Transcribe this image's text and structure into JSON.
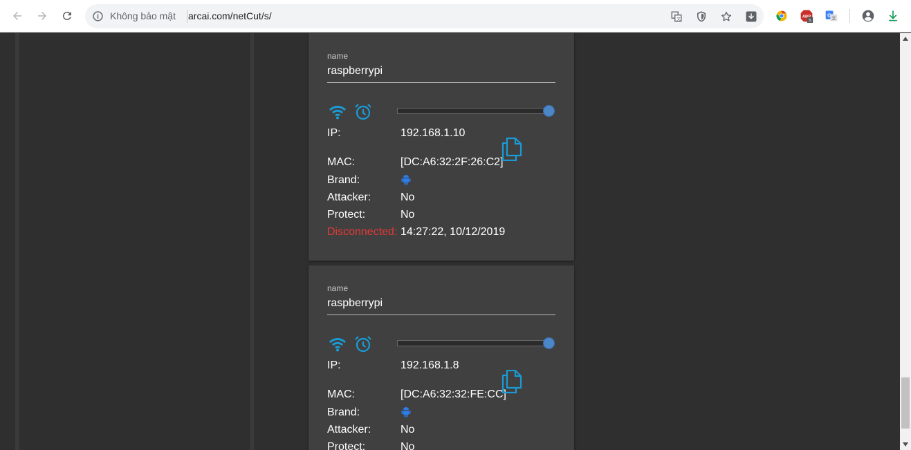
{
  "browser": {
    "security_label": "Không bảo mật",
    "url": "arcai.com/netCut/s/",
    "adblock_badge": "5",
    "abp_label": "ABP"
  },
  "cards": [
    {
      "name_label": "name",
      "name_value": "raspberrypi",
      "ip_label": "IP:",
      "ip_value": "192.168.1.10",
      "mac_label": "MAC:",
      "mac_value": "[DC:A6:32:2F:26:C2]",
      "brand_label": "Brand:",
      "attacker_label": "Attacker:",
      "attacker_value": "No",
      "protect_label": "Protect:",
      "protect_value": "No",
      "disconnected_label": "Disconnected:",
      "disconnected_value": "14:27:22, 10/12/2019"
    },
    {
      "name_label": "name",
      "name_value": "raspberrypi",
      "ip_label": "IP:",
      "ip_value": "192.168.1.8",
      "mac_label": "MAC:",
      "mac_value": "[DC:A6:32:32:FE:CC]",
      "brand_label": "Brand:",
      "attacker_label": "Attacker:",
      "attacker_value": "No",
      "protect_label": "Protect:",
      "protect_value": "No"
    }
  ],
  "colors": {
    "accent": "#1a9bd7",
    "disconnected": "#e53935",
    "card_bg": "#404040",
    "page_bg": "#2f2f2f"
  }
}
